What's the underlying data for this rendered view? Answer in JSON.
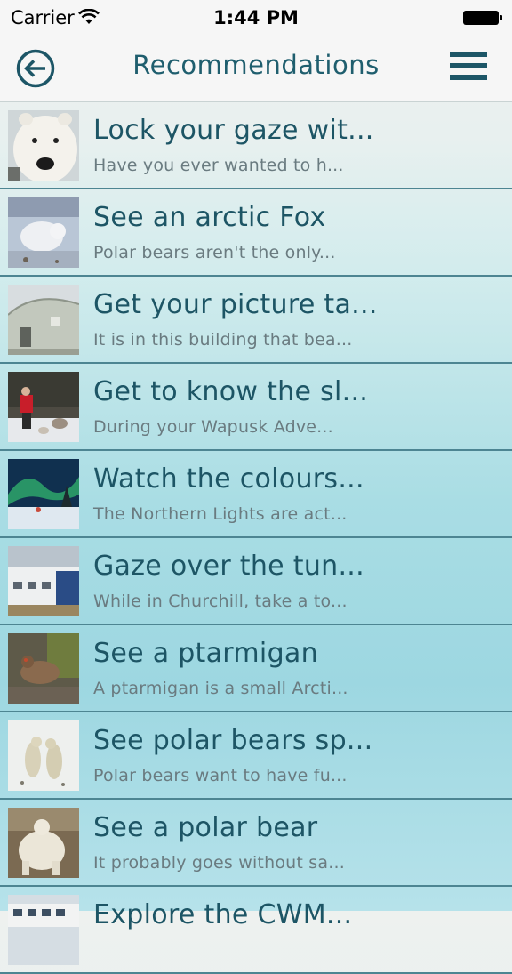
{
  "status": {
    "carrier": "Carrier",
    "time": "1:44 PM"
  },
  "nav": {
    "title": "Recommendations",
    "back_icon": "circle-arrow-left-icon",
    "menu_icon": "hamburger-menu-icon"
  },
  "colors": {
    "accent": "#1d5667",
    "title_text": "#1d5565",
    "subtitle_text": "#6a7b80",
    "divider": "#4d8592"
  },
  "items": [
    {
      "title": "Lock your gaze wit...",
      "subtitle": "Have you ever wanted to h...",
      "image": "polar-bear-face"
    },
    {
      "title": "See an arctic Fox",
      "subtitle": "Polar bears aren't the only...",
      "image": "arctic-fox"
    },
    {
      "title": "Get your picture ta...",
      "subtitle": "It is in this building that bea...",
      "image": "quonset-building"
    },
    {
      "title": "Get to know the sl...",
      "subtitle": "During your Wapusk Adve...",
      "image": "sled-dogs"
    },
    {
      "title": "Watch the colours...",
      "subtitle": "The Northern Lights are act...",
      "image": "northern-lights"
    },
    {
      "title": "Gaze over the tun...",
      "subtitle": "While in Churchill, take a to...",
      "image": "tundra-building"
    },
    {
      "title": "See a ptarmigan",
      "subtitle": "A ptarmigan is a small Arcti...",
      "image": "ptarmigan"
    },
    {
      "title": "See polar bears sp...",
      "subtitle": "Polar bears want to have fu...",
      "image": "sparring-bears"
    },
    {
      "title": "See a polar bear",
      "subtitle": "It probably goes without sa...",
      "image": "polar-bear"
    },
    {
      "title": "Explore the CWM...",
      "subtitle": "",
      "image": "tundra-buggy"
    }
  ]
}
